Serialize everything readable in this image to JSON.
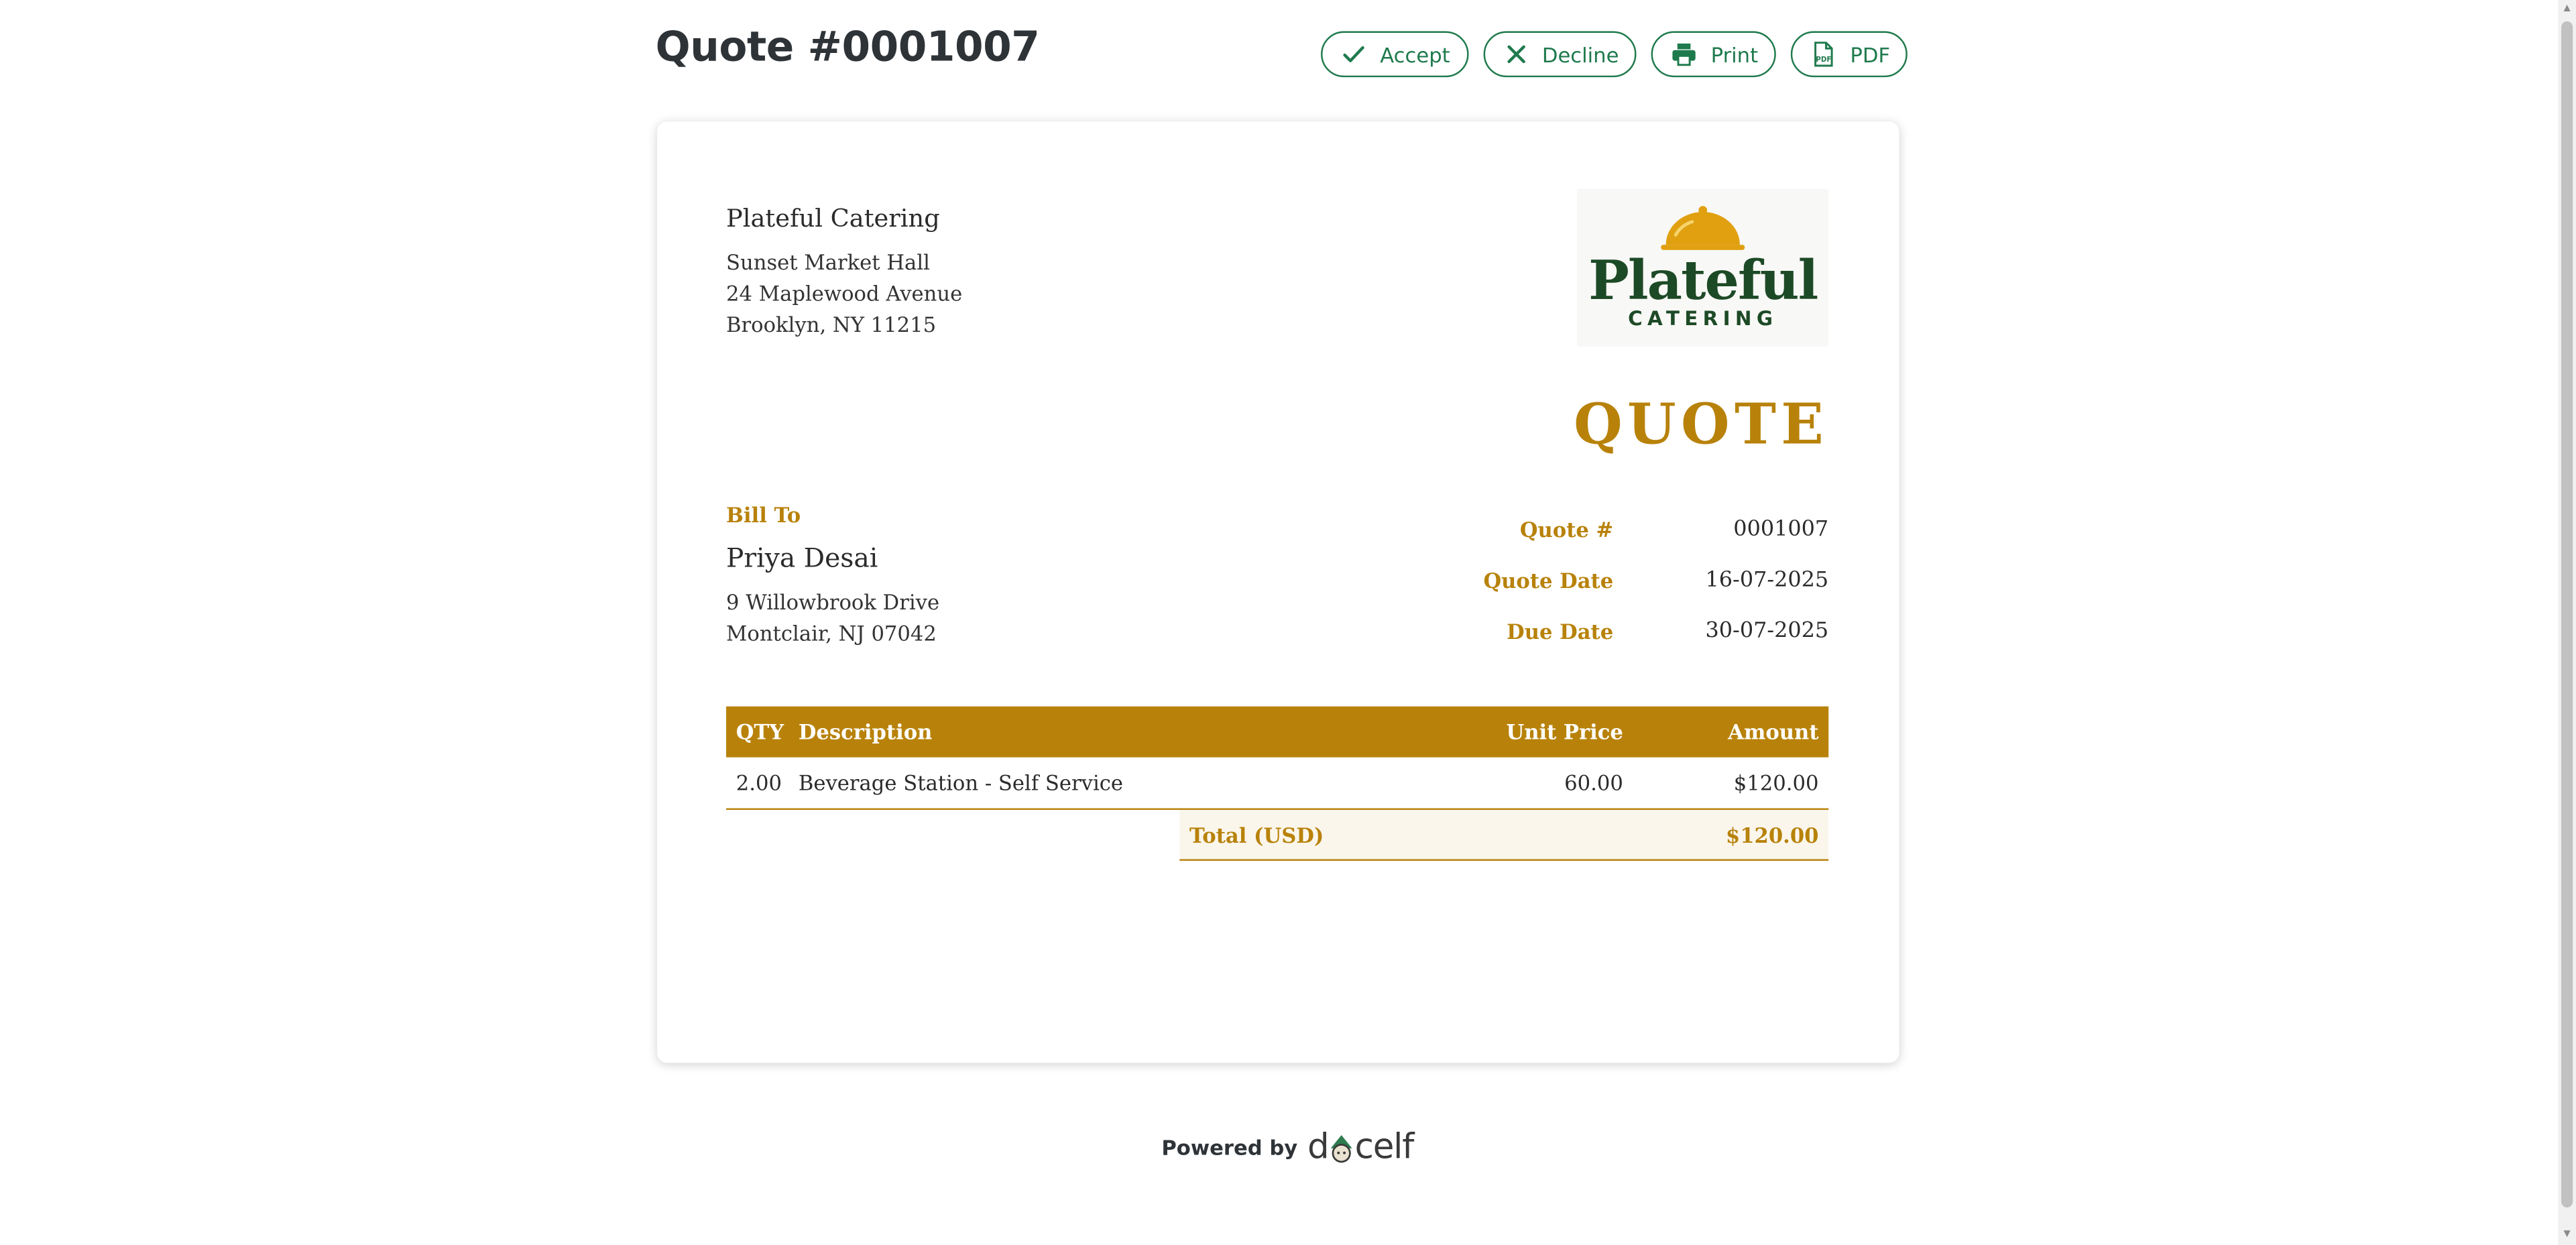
{
  "page": {
    "title": "Quote #0001007"
  },
  "toolbar": {
    "accept_label": "Accept",
    "decline_label": "Decline",
    "print_label": "Print",
    "pdf_label": "PDF",
    "accent_color": "#1f7a4d"
  },
  "document": {
    "heading": "QUOTE",
    "accent_color": "#b8820a",
    "from": {
      "name": "Plateful Catering",
      "address": [
        "Sunset Market Hall",
        "24 Maplewood Avenue",
        "Brooklyn, NY 11215"
      ]
    },
    "logo": {
      "text_main": "Plateful",
      "text_sub": "CATERING",
      "icon": "cloche-icon"
    },
    "bill_to": {
      "label": "Bill To",
      "name": "Priya Desai",
      "address": [
        "9 Willowbrook Drive",
        "Montclair, NJ 07042"
      ]
    },
    "meta": [
      {
        "label": "Quote #",
        "value": "0001007"
      },
      {
        "label": "Quote Date",
        "value": "16-07-2025"
      },
      {
        "label": "Due Date",
        "value": "30-07-2025"
      }
    ],
    "table": {
      "headers": {
        "qty": "QTY",
        "description": "Description",
        "unit_price": "Unit Price",
        "amount": "Amount"
      },
      "rows": [
        {
          "qty": "2.00",
          "description": "Beverage Station - Self Service",
          "unit_price": "60.00",
          "amount": "$120.00"
        }
      ],
      "total_label": "Total (USD)",
      "total_value": "$120.00"
    }
  },
  "footer": {
    "powered_by": "Powered by",
    "brand_prefix": "d",
    "brand_suffix": "celf"
  }
}
